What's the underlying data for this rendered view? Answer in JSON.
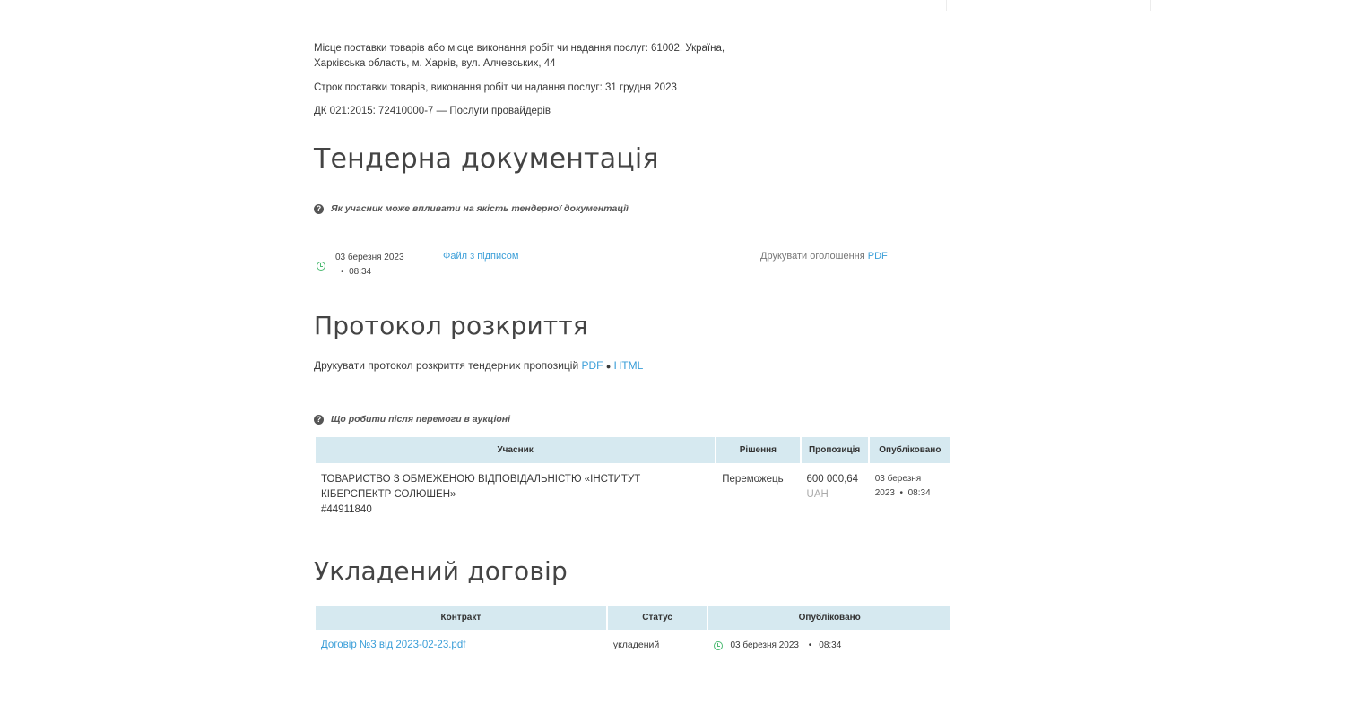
{
  "info": {
    "delivery_place": "Місце поставки товарів або місце виконання робіт чи надання послуг: 61002, Україна,",
    "delivery_place_2": "Харківська область, м. Харків, вул. Алчевських, 44",
    "delivery_term": "Строк поставки товарів, виконання робіт чи надання послуг: 31 грудня 2023",
    "classifier": "ДК 021:2015: 72410000-7 — Послуги провайдерів"
  },
  "tender_docs": {
    "title": "Тендерна документація",
    "help_text": "Як учасник може впливати на якість тендерної документації",
    "date": "03 березня 2023",
    "time": "08:34",
    "file_link": "Файл з підписом",
    "print_label": "Друкувати оголошення",
    "print_pdf": "PDF"
  },
  "protocol": {
    "title": "Протокол розкриття",
    "print_text": "Друкувати протокол розкриття тендерних пропозицій",
    "pdf": "PDF",
    "separator": "●",
    "html": "HTML",
    "help_text": "Що робити після перемоги в аукціоні",
    "columns": [
      "Учасник",
      "Рішення",
      "Пропозиція",
      "Опубліковано"
    ],
    "row": {
      "participant_line1": "ТОВАРИСТВО З ОБМЕЖЕНОЮ ВІДПОВІДАЛЬНІСТЮ «ІНСТИТУТ",
      "participant_line2": "КІБЕРСПЕКТР СОЛЮШЕН»",
      "participant_id": "#44911840",
      "decision": "Переможець",
      "amount": "600 000,64",
      "currency": "UAH",
      "published_date": "03 березня",
      "published_year": "2023",
      "published_time": "08:34"
    }
  },
  "contract": {
    "title": "Укладений договір",
    "columns": [
      "Контракт",
      "Статус",
      "Опубліковано"
    ],
    "row": {
      "name": "Договір №3 від 2023-02-23.pdf",
      "status": "укладений",
      "date": "03 березня 2023",
      "time": "08:34"
    }
  },
  "colors": {
    "link": "#3a9ed8",
    "table_header": "#d6e9f0",
    "clock": "#4cba72"
  }
}
